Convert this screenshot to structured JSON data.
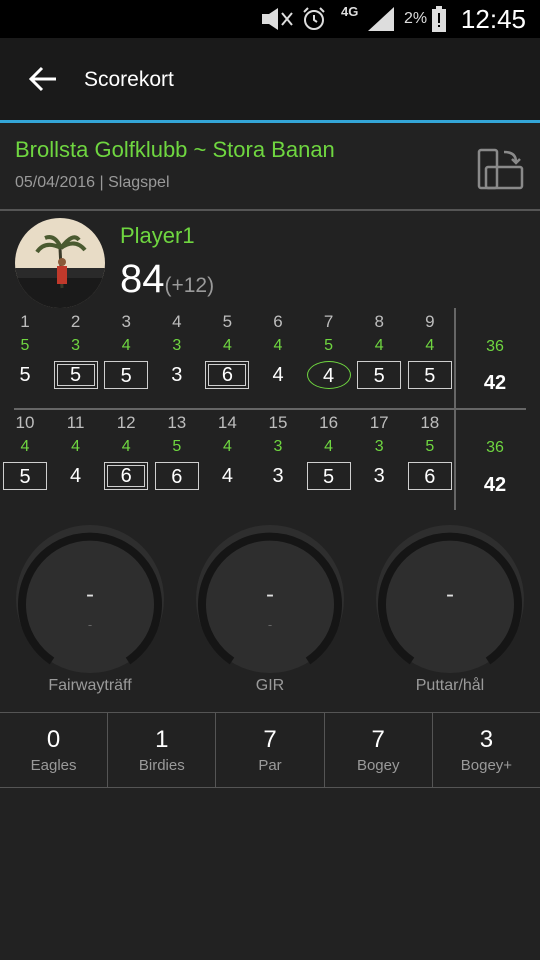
{
  "status_bar": {
    "network": "4G",
    "battery": "2%",
    "time": "12:45"
  },
  "app_bar": {
    "title": "Scorekort"
  },
  "round": {
    "course": "Brollsta Golfklubb ~ Stora Banan",
    "meta": "05/04/2016 | Slagspel"
  },
  "player": {
    "name": "Player1",
    "total": "84",
    "relative": "(+12)"
  },
  "scorecard": {
    "front": {
      "holes": [
        "1",
        "2",
        "3",
        "4",
        "5",
        "6",
        "7",
        "8",
        "9"
      ],
      "pars": [
        "5",
        "3",
        "4",
        "3",
        "4",
        "4",
        "5",
        "4",
        "4"
      ],
      "scores": [
        "5",
        "5",
        "5",
        "3",
        "6",
        "4",
        "4",
        "5",
        "5"
      ],
      "marks": [
        "none",
        "double",
        "square",
        "none",
        "double",
        "none",
        "circle",
        "square",
        "square"
      ],
      "par_total": "36",
      "score_total": "42"
    },
    "back": {
      "holes": [
        "10",
        "11",
        "12",
        "13",
        "14",
        "15",
        "16",
        "17",
        "18"
      ],
      "pars": [
        "4",
        "4",
        "4",
        "5",
        "4",
        "3",
        "4",
        "3",
        "5"
      ],
      "scores": [
        "5",
        "4",
        "6",
        "6",
        "4",
        "3",
        "5",
        "3",
        "6"
      ],
      "marks": [
        "square",
        "none",
        "double",
        "square",
        "none",
        "none",
        "square",
        "none",
        "square"
      ],
      "par_total": "36",
      "score_total": "42"
    }
  },
  "gauges": [
    {
      "label": "Fairwayträff",
      "value": "-",
      "sub": "-"
    },
    {
      "label": "GIR",
      "value": "-",
      "sub": "-"
    },
    {
      "label": "Puttar/hål",
      "value": "-",
      "sub": ""
    }
  ],
  "stats": [
    {
      "value": "0",
      "label": "Eagles"
    },
    {
      "value": "1",
      "label": "Birdies"
    },
    {
      "value": "7",
      "label": "Par"
    },
    {
      "value": "7",
      "label": "Bogey"
    },
    {
      "value": "3",
      "label": "Bogey+"
    }
  ],
  "colors": {
    "accent_green": "#6fd640",
    "accent_blue": "#34a6d8",
    "background": "#222222"
  }
}
